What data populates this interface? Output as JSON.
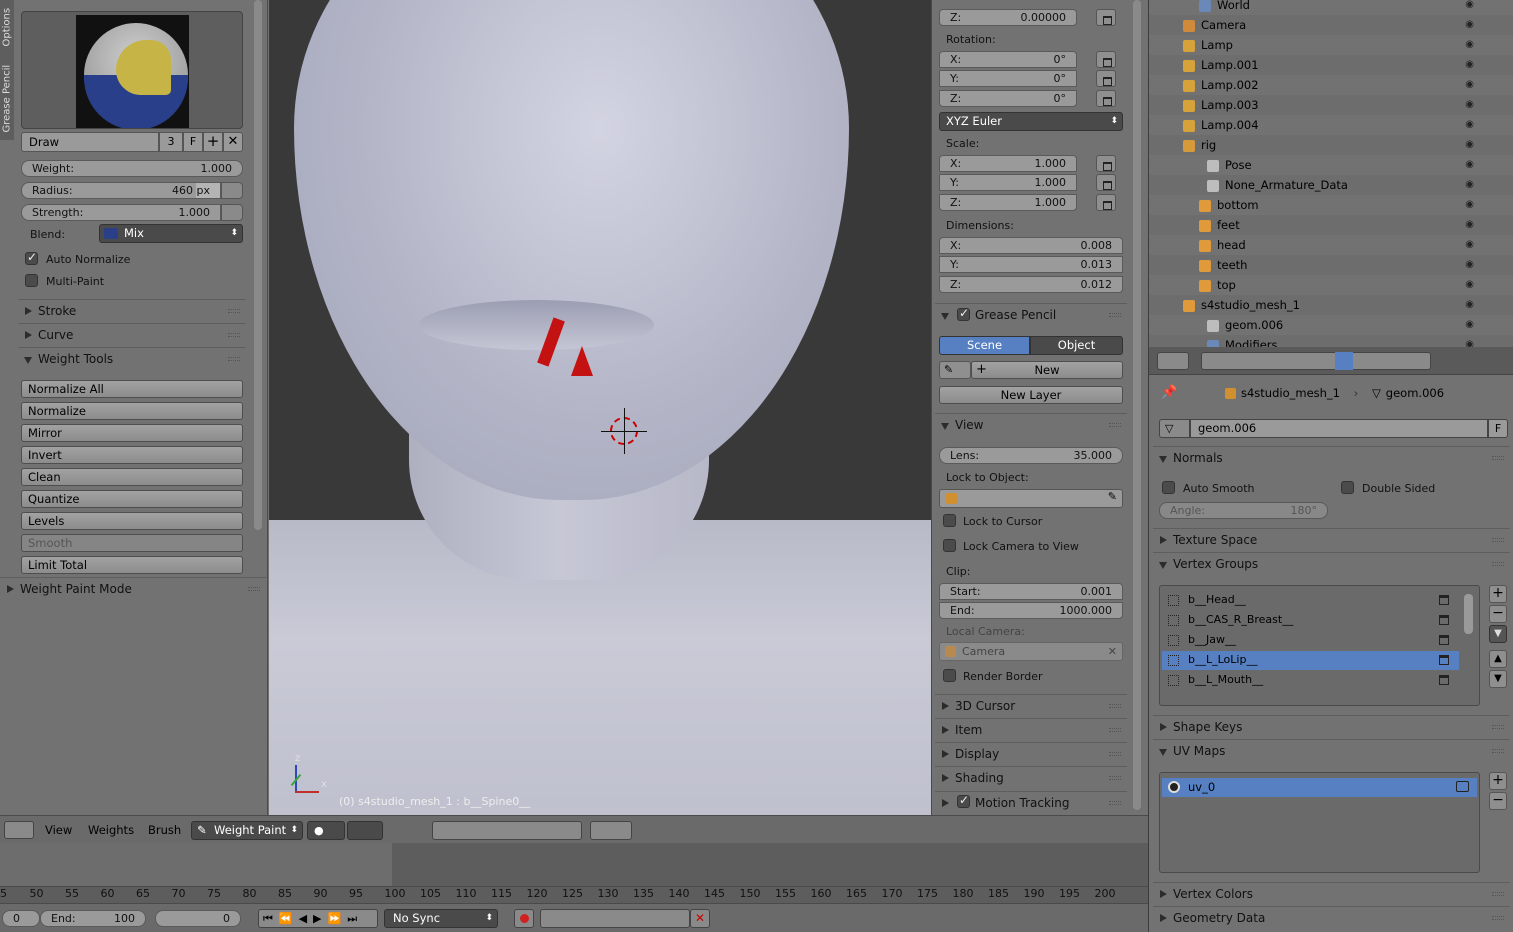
{
  "tool_panel": {
    "sidebar_tabs": [
      "Options",
      "Grease Pencil"
    ],
    "brush_name": "Draw",
    "brush_users": "3",
    "brush_fake": "F",
    "weight_label": "Weight:",
    "weight_value": "1.000",
    "radius_label": "Radius:",
    "radius_value": "460 px",
    "strength_label": "Strength:",
    "strength_value": "1.000",
    "blend_label": "Blend:",
    "blend_value": "Mix",
    "auto_normalize": "Auto Normalize",
    "multi_paint": "Multi-Paint",
    "stroke": "Stroke",
    "curve": "Curve",
    "weight_tools": "Weight Tools",
    "tools": [
      "Normalize All",
      "Normalize",
      "Mirror",
      "Invert",
      "Clean",
      "Quantize",
      "Levels",
      "Smooth",
      "Limit Total"
    ],
    "mode_panel": "Weight Paint Mode"
  },
  "viewport": {
    "status": "(0) s4studio_mesh_1 : b__Spine0__",
    "axis_z": "z",
    "axis_x": "x"
  },
  "properties_n": {
    "loc_z_label": "Z:",
    "loc_z_value": "0.00000",
    "rotation_label": "Rotation:",
    "rot": [
      {
        "k": "X:",
        "v": "0°"
      },
      {
        "k": "Y:",
        "v": "0°"
      },
      {
        "k": "Z:",
        "v": "0°"
      }
    ],
    "rotation_mode": "XYZ Euler",
    "scale_label": "Scale:",
    "scale": [
      {
        "k": "X:",
        "v": "1.000"
      },
      {
        "k": "Y:",
        "v": "1.000"
      },
      {
        "k": "Z:",
        "v": "1.000"
      }
    ],
    "dimensions_label": "Dimensions:",
    "dims": [
      {
        "k": "X:",
        "v": "0.008"
      },
      {
        "k": "Y:",
        "v": "0.013"
      },
      {
        "k": "Z:",
        "v": "0.012"
      }
    ],
    "grease_pencil": "Grease Pencil",
    "scene_tab": "Scene",
    "object_tab": "Object",
    "new_btn": "New",
    "new_layer": "New Layer",
    "view": "View",
    "lens_label": "Lens:",
    "lens_value": "35.000",
    "lock_to_object": "Lock to Object:",
    "lock_to_cursor": "Lock to Cursor",
    "lock_camera": "Lock Camera to View",
    "clip": "Clip:",
    "clip_start_label": "Start:",
    "clip_start": "0.001",
    "clip_end_label": "End:",
    "clip_end": "1000.000",
    "local_camera": "Local Camera:",
    "camera_field": "Camera",
    "render_border": "Render Border",
    "cursor3d": "3D Cursor",
    "item": "Item",
    "display": "Display",
    "shading": "Shading",
    "motion_tracking": "Motion Tracking"
  },
  "outliner": {
    "rows": [
      {
        "label": "World",
        "color": "#6a88b8"
      },
      {
        "label": "Camera",
        "color": "#d08a3a"
      },
      {
        "label": "Lamp",
        "color": "#d6a23a"
      },
      {
        "label": "Lamp.001",
        "color": "#d6a23a"
      },
      {
        "label": "Lamp.002",
        "color": "#d6a23a"
      },
      {
        "label": "Lamp.003",
        "color": "#d6a23a"
      },
      {
        "label": "Lamp.004",
        "color": "#d6a23a"
      },
      {
        "label": "rig",
        "color": "#d69a3a"
      },
      {
        "label": "Pose",
        "color": "#bdbdbd"
      },
      {
        "label": "None_Armature_Data",
        "color": "#bdbdbd"
      },
      {
        "label": "bottom",
        "color": "#e09a3a"
      },
      {
        "label": "feet",
        "color": "#e09a3a"
      },
      {
        "label": "head",
        "color": "#e09a3a"
      },
      {
        "label": "teeth",
        "color": "#e09a3a"
      },
      {
        "label": "top",
        "color": "#e09a3a"
      },
      {
        "label": "s4studio_mesh_1",
        "color": "#e09a3a"
      },
      {
        "label": "geom.006",
        "color": "#bdbdbd"
      },
      {
        "label": "Modifiers",
        "color": "#6a88b8"
      }
    ]
  },
  "properties": {
    "breadcrumb_object": "s4studio_mesh_1",
    "breadcrumb_data": "geom.006",
    "datablock": "geom.006",
    "datablock_fake": "F",
    "normals": "Normals",
    "auto_smooth": "Auto Smooth",
    "double_sided": "Double Sided",
    "angle_label": "Angle:",
    "angle_value": "180°",
    "texture_space": "Texture Space",
    "vertex_groups": "Vertex Groups",
    "groups": [
      "b__Head__",
      "b__CAS_R_Breast__",
      "b__Jaw__",
      "b__L_LoLip__",
      "b__L_Mouth__"
    ],
    "shape_keys": "Shape Keys",
    "uv_maps": "UV Maps",
    "uv_item": "uv_0",
    "vertex_colors": "Vertex Colors",
    "geometry_data": "Geometry Data"
  },
  "header3d": {
    "view": "View",
    "weights": "Weights",
    "brush": "Brush",
    "mode": "Weight Paint"
  },
  "timeline": {
    "ticks": [
      "5",
      "50",
      "55",
      "60",
      "65",
      "70",
      "75",
      "80",
      "85",
      "90",
      "95",
      "100",
      "105",
      "110",
      "115",
      "120",
      "125",
      "130",
      "135",
      "140",
      "145",
      "150",
      "155",
      "160",
      "165",
      "170",
      "175",
      "180",
      "185",
      "190",
      "195",
      "200"
    ],
    "start_value": "0",
    "end_label": "End:",
    "end_value": "100",
    "current": "0",
    "sync": "No Sync"
  }
}
